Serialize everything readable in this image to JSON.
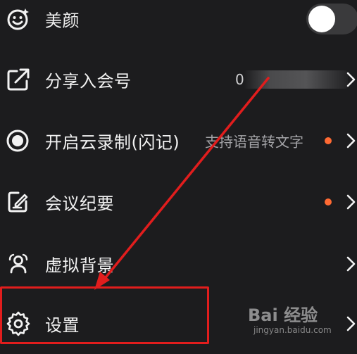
{
  "menu": {
    "items": [
      {
        "label": "美颜",
        "icon": "smiley-icon",
        "control": "toggle",
        "toggle_on": false
      },
      {
        "label": "分享入会号",
        "icon": "share-icon",
        "value_partial": "0",
        "redacted": true
      },
      {
        "label": "开启云录制(闪记)",
        "icon": "record-icon",
        "sub": "支持语音转文字",
        "dot": true
      },
      {
        "label": "会议纪要",
        "icon": "notes-edit-icon",
        "dot": true
      },
      {
        "label": "虚拟背景",
        "icon": "virtual-background-icon"
      },
      {
        "label": "设置",
        "icon": "gear-icon"
      }
    ]
  },
  "colors": {
    "background": "#1c1c1e",
    "text": "#f2f2f2",
    "subtext": "#a3a3a7",
    "dot": "#ff6a33",
    "annotation": "#e11d1d"
  },
  "watermark": {
    "brand": "Bai 经验",
    "url": "jingyan.baidu.com"
  }
}
